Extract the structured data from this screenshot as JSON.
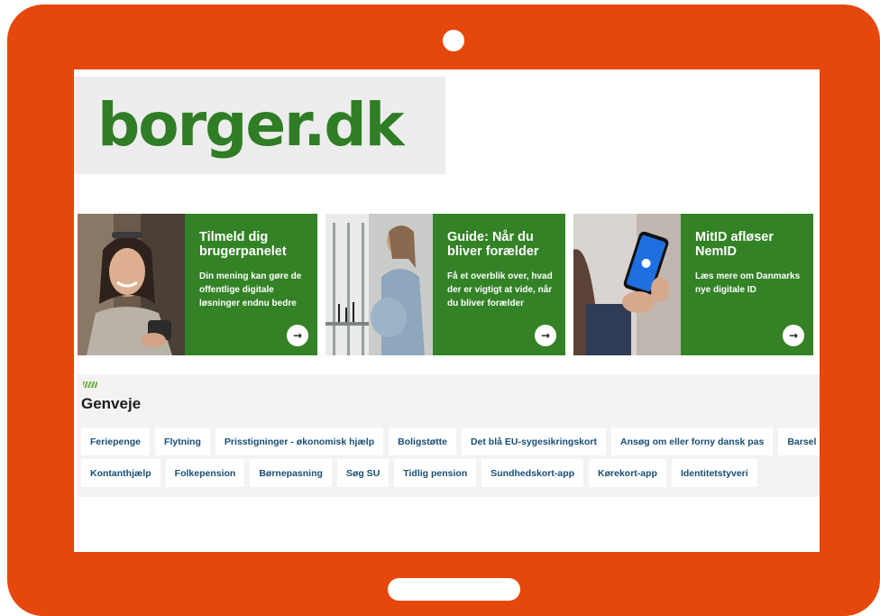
{
  "colors": {
    "frame": "#e5470c",
    "brand_green": "#2f7d25",
    "card_green": "#338226",
    "chip_text": "#174e76"
  },
  "logo": {
    "text": "borger.dk"
  },
  "cards": [
    {
      "title": "Tilmeld dig brugerpanelet",
      "text": "Din mening kan gøre de offentlige digitale løsninger endnu bedre",
      "arrow_icon": "arrow-right-icon"
    },
    {
      "title": "Guide: Når du bliver forælder",
      "text": "Få et overblik over, hvad der er vigtigt at vide, når du bliver forælder",
      "arrow_icon": "arrow-right-icon"
    },
    {
      "title": "MitID afløser NemID",
      "text": "Læs mere om Danmarks nye digitale ID",
      "arrow_icon": "arrow-right-icon"
    }
  ],
  "shortcuts": {
    "title": "Genveje",
    "row1": [
      "Feriepenge",
      "Flytning",
      "Prisstigninger - økonomisk hjælp",
      "Boligstøtte",
      "Det blå EU-sygesikringskort",
      "Ansøg om eller forny dansk pas",
      "Barsel"
    ],
    "row2": [
      "Kontanthjælp",
      "Folkepension",
      "Børnepasning",
      "Søg SU",
      "Tidlig pension",
      "Sundhedskort-app",
      "Kørekort-app",
      "Identitetstyveri"
    ]
  }
}
